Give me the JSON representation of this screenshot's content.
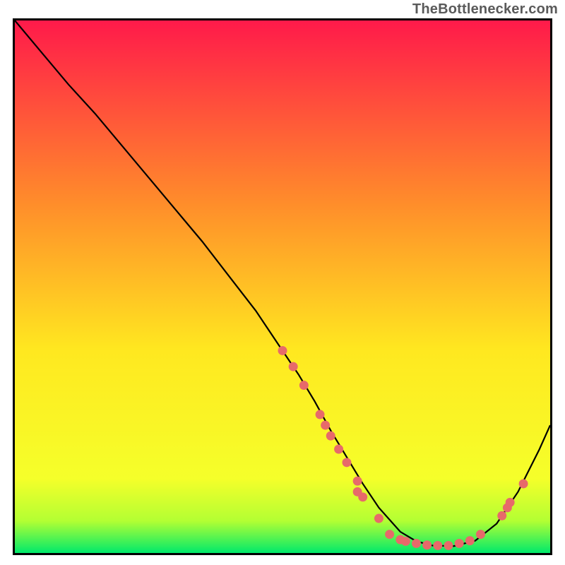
{
  "attribution": "TheBottlenecker.com",
  "chart_data": {
    "type": "line",
    "title": "",
    "xlabel": "",
    "ylabel": "",
    "xlim": [
      0,
      100
    ],
    "ylim": [
      0,
      100
    ],
    "background_gradient": {
      "top": "#ff1a4a",
      "mid_upper": "#ff8f2a",
      "mid": "#ffe820",
      "mid_lower": "#f5ff2a",
      "bottom_band_top": "#b3ff33",
      "bottom": "#00e96b"
    },
    "series": [
      {
        "name": "bottleneck-curve",
        "color": "#000000",
        "x": [
          0,
          5,
          10,
          15,
          20,
          25,
          30,
          35,
          40,
          45,
          50,
          53,
          56,
          59,
          62,
          65,
          68,
          72,
          75,
          78,
          82,
          86,
          90,
          94,
          98,
          100
        ],
        "y": [
          100,
          94,
          88,
          82.5,
          76.5,
          70.5,
          64.5,
          58.5,
          52,
          45.5,
          38,
          33.5,
          28.5,
          23,
          18,
          13,
          8.5,
          4,
          2.2,
          1.4,
          1.3,
          2.3,
          5.5,
          11.5,
          19.5,
          24
        ]
      }
    ],
    "markers": {
      "name": "highlight-points",
      "color": "#e76a6a",
      "points": [
        {
          "x": 50,
          "y": 38
        },
        {
          "x": 52,
          "y": 35
        },
        {
          "x": 54,
          "y": 31.5
        },
        {
          "x": 57,
          "y": 26
        },
        {
          "x": 58,
          "y": 24
        },
        {
          "x": 59,
          "y": 22
        },
        {
          "x": 60.5,
          "y": 19.5
        },
        {
          "x": 62,
          "y": 17
        },
        {
          "x": 64,
          "y": 13.5
        },
        {
          "x": 64,
          "y": 11.5
        },
        {
          "x": 65,
          "y": 10.5
        },
        {
          "x": 68,
          "y": 6.5
        },
        {
          "x": 70,
          "y": 3.5
        },
        {
          "x": 72,
          "y": 2.5
        },
        {
          "x": 73,
          "y": 2.2
        },
        {
          "x": 75,
          "y": 1.8
        },
        {
          "x": 77,
          "y": 1.5
        },
        {
          "x": 79,
          "y": 1.4
        },
        {
          "x": 81,
          "y": 1.4
        },
        {
          "x": 83,
          "y": 1.8
        },
        {
          "x": 85,
          "y": 2.3
        },
        {
          "x": 87,
          "y": 3.5
        },
        {
          "x": 91,
          "y": 7
        },
        {
          "x": 92,
          "y": 8.5
        },
        {
          "x": 92.5,
          "y": 9.5
        },
        {
          "x": 95,
          "y": 13
        }
      ]
    }
  }
}
